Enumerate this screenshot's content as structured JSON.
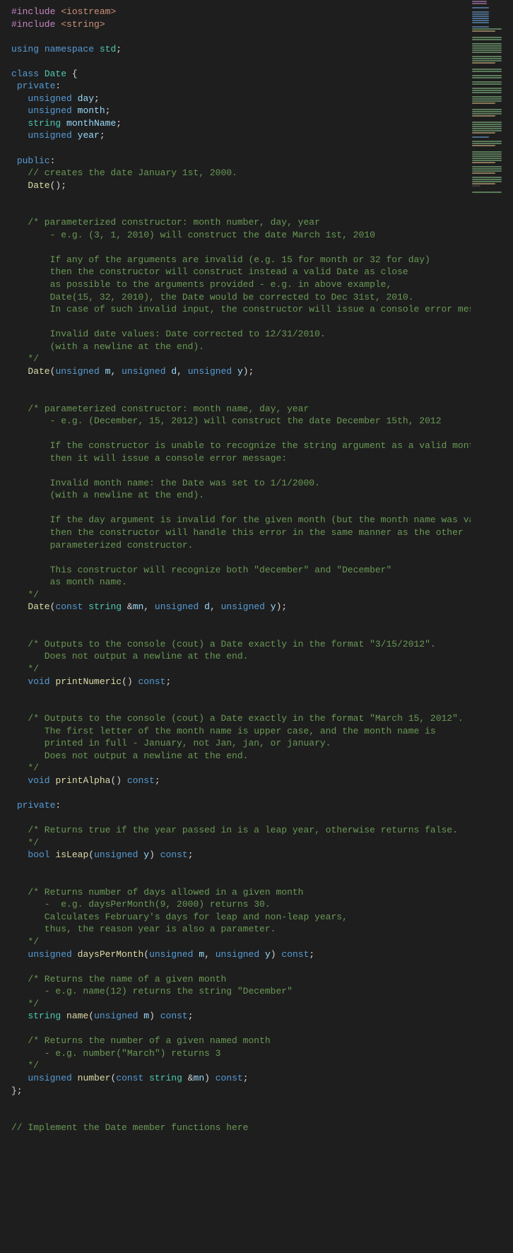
{
  "lines": [
    {
      "segs": [
        {
          "t": "#include",
          "c": "preproc"
        },
        {
          "t": " ",
          "c": "punct"
        },
        {
          "t": "<iostream>",
          "c": "include-path"
        }
      ]
    },
    {
      "segs": [
        {
          "t": "#include",
          "c": "preproc"
        },
        {
          "t": " ",
          "c": "punct"
        },
        {
          "t": "<string>",
          "c": "include-path"
        }
      ]
    },
    {
      "segs": []
    },
    {
      "segs": [
        {
          "t": "using",
          "c": "keyword"
        },
        {
          "t": " ",
          "c": "punct"
        },
        {
          "t": "namespace",
          "c": "keyword"
        },
        {
          "t": " ",
          "c": "punct"
        },
        {
          "t": "std",
          "c": "namespace"
        },
        {
          "t": ";",
          "c": "punct"
        }
      ]
    },
    {
      "segs": []
    },
    {
      "segs": [
        {
          "t": "class",
          "c": "keyword"
        },
        {
          "t": " ",
          "c": "punct"
        },
        {
          "t": "Date",
          "c": "class"
        },
        {
          "t": " {",
          "c": "punct"
        }
      ]
    },
    {
      "segs": [
        {
          "t": " ",
          "c": "punct"
        },
        {
          "t": "private",
          "c": "keyword"
        },
        {
          "t": ":",
          "c": "punct"
        }
      ]
    },
    {
      "segs": [
        {
          "t": "   ",
          "c": "punct"
        },
        {
          "t": "unsigned",
          "c": "type"
        },
        {
          "t": " ",
          "c": "punct"
        },
        {
          "t": "day",
          "c": "ident"
        },
        {
          "t": ";",
          "c": "punct"
        }
      ]
    },
    {
      "segs": [
        {
          "t": "   ",
          "c": "punct"
        },
        {
          "t": "unsigned",
          "c": "type"
        },
        {
          "t": " ",
          "c": "punct"
        },
        {
          "t": "month",
          "c": "ident"
        },
        {
          "t": ";",
          "c": "punct"
        }
      ]
    },
    {
      "segs": [
        {
          "t": "   ",
          "c": "punct"
        },
        {
          "t": "string",
          "c": "class"
        },
        {
          "t": " ",
          "c": "punct"
        },
        {
          "t": "monthName",
          "c": "ident"
        },
        {
          "t": ";",
          "c": "punct"
        }
      ]
    },
    {
      "segs": [
        {
          "t": "   ",
          "c": "punct"
        },
        {
          "t": "unsigned",
          "c": "type"
        },
        {
          "t": " ",
          "c": "punct"
        },
        {
          "t": "year",
          "c": "ident"
        },
        {
          "t": ";",
          "c": "punct"
        }
      ]
    },
    {
      "segs": []
    },
    {
      "segs": [
        {
          "t": " ",
          "c": "punct"
        },
        {
          "t": "public",
          "c": "keyword"
        },
        {
          "t": ":",
          "c": "punct"
        }
      ]
    },
    {
      "segs": [
        {
          "t": "   ",
          "c": "punct"
        },
        {
          "t": "// creates the date January 1st, 2000.",
          "c": "comment"
        }
      ]
    },
    {
      "segs": [
        {
          "t": "   ",
          "c": "punct"
        },
        {
          "t": "Date",
          "c": "func"
        },
        {
          "t": "();",
          "c": "punct"
        }
      ]
    },
    {
      "segs": []
    },
    {
      "segs": []
    },
    {
      "segs": [
        {
          "t": "   ",
          "c": "punct"
        },
        {
          "t": "/* parameterized constructor: month number, day, year ",
          "c": "comment"
        }
      ]
    },
    {
      "segs": [
        {
          "t": "       - e.g. (3, 1, 2010) will construct the date March 1st, 2010",
          "c": "comment"
        }
      ]
    },
    {
      "segs": []
    },
    {
      "segs": [
        {
          "t": "       If any of the arguments are invalid (e.g. 15 for month or 32 for day)",
          "c": "comment"
        }
      ]
    },
    {
      "segs": [
        {
          "t": "       then the constructor will construct instead a valid Date as close",
          "c": "comment"
        }
      ]
    },
    {
      "segs": [
        {
          "t": "       as possible to the arguments provided - e.g. in above example,",
          "c": "comment"
        }
      ]
    },
    {
      "segs": [
        {
          "t": "       Date(15, 32, 2010), the Date would be corrected to Dec 31st, 2010.",
          "c": "comment"
        }
      ]
    },
    {
      "segs": [
        {
          "t": "       In case of such invalid input, the constructor will issue a console error message: ",
          "c": "comment"
        }
      ]
    },
    {
      "segs": []
    },
    {
      "segs": [
        {
          "t": "       Invalid date values: Date corrected to 12/31/2010.",
          "c": "comment"
        }
      ]
    },
    {
      "segs": [
        {
          "t": "       (with a newline at the end).",
          "c": "comment"
        }
      ]
    },
    {
      "segs": [
        {
          "t": "   ",
          "c": "punct"
        },
        {
          "t": "*/",
          "c": "comment"
        }
      ]
    },
    {
      "segs": [
        {
          "t": "   ",
          "c": "punct"
        },
        {
          "t": "Date",
          "c": "func"
        },
        {
          "t": "(",
          "c": "punct"
        },
        {
          "t": "unsigned",
          "c": "type"
        },
        {
          "t": " ",
          "c": "punct"
        },
        {
          "t": "m",
          "c": "param"
        },
        {
          "t": ", ",
          "c": "punct"
        },
        {
          "t": "unsigned",
          "c": "type"
        },
        {
          "t": " ",
          "c": "punct"
        },
        {
          "t": "d",
          "c": "param"
        },
        {
          "t": ", ",
          "c": "punct"
        },
        {
          "t": "unsigned",
          "c": "type"
        },
        {
          "t": " ",
          "c": "punct"
        },
        {
          "t": "y",
          "c": "param"
        },
        {
          "t": ");",
          "c": "punct"
        }
      ]
    },
    {
      "segs": []
    },
    {
      "segs": []
    },
    {
      "segs": [
        {
          "t": "   ",
          "c": "punct"
        },
        {
          "t": "/* parameterized constructor: month name, day, year",
          "c": "comment"
        }
      ]
    },
    {
      "segs": [
        {
          "t": "       - e.g. (December, 15, 2012) will construct the date December 15th, 2012",
          "c": "comment"
        }
      ]
    },
    {
      "segs": []
    },
    {
      "segs": [
        {
          "t": "       If the constructor is unable to recognize the string argument as a valid month name,",
          "c": "comment"
        }
      ]
    },
    {
      "segs": [
        {
          "t": "       then it will issue a console error message: ",
          "c": "comment"
        }
      ]
    },
    {
      "segs": []
    },
    {
      "segs": [
        {
          "t": "       Invalid month name: the Date was set to 1/1/2000.",
          "c": "comment"
        }
      ]
    },
    {
      "segs": [
        {
          "t": "       (with a newline at the end).",
          "c": "comment"
        }
      ]
    },
    {
      "segs": []
    },
    {
      "segs": [
        {
          "t": "       If the day argument is invalid for the given month (but the month name was valid),",
          "c": "comment"
        }
      ]
    },
    {
      "segs": [
        {
          "t": "       then the constructor will handle this error in the same manner as the other",
          "c": "comment"
        }
      ]
    },
    {
      "segs": [
        {
          "t": "       parameterized constructor. ",
          "c": "comment"
        }
      ]
    },
    {
      "segs": []
    },
    {
      "segs": [
        {
          "t": "       This constructor will recognize both \"december\" and \"December\"",
          "c": "comment"
        }
      ]
    },
    {
      "segs": [
        {
          "t": "       as month name.",
          "c": "comment"
        }
      ]
    },
    {
      "segs": [
        {
          "t": "   ",
          "c": "punct"
        },
        {
          "t": "*/",
          "c": "comment"
        }
      ]
    },
    {
      "segs": [
        {
          "t": "   ",
          "c": "punct"
        },
        {
          "t": "Date",
          "c": "func"
        },
        {
          "t": "(",
          "c": "punct"
        },
        {
          "t": "const",
          "c": "keyword"
        },
        {
          "t": " ",
          "c": "punct"
        },
        {
          "t": "string",
          "c": "class"
        },
        {
          "t": " &",
          "c": "punct"
        },
        {
          "t": "mn",
          "c": "param"
        },
        {
          "t": ", ",
          "c": "punct"
        },
        {
          "t": "unsigned",
          "c": "type"
        },
        {
          "t": " ",
          "c": "punct"
        },
        {
          "t": "d",
          "c": "param"
        },
        {
          "t": ", ",
          "c": "punct"
        },
        {
          "t": "unsigned",
          "c": "type"
        },
        {
          "t": " ",
          "c": "punct"
        },
        {
          "t": "y",
          "c": "param"
        },
        {
          "t": ");",
          "c": "punct"
        }
      ]
    },
    {
      "segs": []
    },
    {
      "segs": []
    },
    {
      "segs": [
        {
          "t": "   ",
          "c": "punct"
        },
        {
          "t": "/* Outputs to the console (cout) a Date exactly in the format \"3/15/2012\".",
          "c": "comment"
        }
      ]
    },
    {
      "segs": [
        {
          "t": "      Does not output a newline at the end.",
          "c": "comment"
        }
      ]
    },
    {
      "segs": [
        {
          "t": "   ",
          "c": "punct"
        },
        {
          "t": "*/",
          "c": "comment"
        }
      ]
    },
    {
      "segs": [
        {
          "t": "   ",
          "c": "punct"
        },
        {
          "t": "void",
          "c": "type"
        },
        {
          "t": " ",
          "c": "punct"
        },
        {
          "t": "printNumeric",
          "c": "func"
        },
        {
          "t": "() ",
          "c": "punct"
        },
        {
          "t": "const",
          "c": "keyword"
        },
        {
          "t": ";",
          "c": "punct"
        }
      ]
    },
    {
      "segs": []
    },
    {
      "segs": []
    },
    {
      "segs": [
        {
          "t": "   ",
          "c": "punct"
        },
        {
          "t": "/* Outputs to the console (cout) a Date exactly in the format \"March 15, 2012\".",
          "c": "comment"
        }
      ]
    },
    {
      "segs": [
        {
          "t": "      The first letter of the month name is upper case, and the month name is",
          "c": "comment"
        }
      ]
    },
    {
      "segs": [
        {
          "t": "      printed in full - January, not Jan, jan, or january. ",
          "c": "comment"
        }
      ]
    },
    {
      "segs": [
        {
          "t": "      Does not output a newline at the end.",
          "c": "comment"
        }
      ]
    },
    {
      "segs": [
        {
          "t": "   ",
          "c": "punct"
        },
        {
          "t": "*/",
          "c": "comment"
        }
      ]
    },
    {
      "segs": [
        {
          "t": "   ",
          "c": "punct"
        },
        {
          "t": "void",
          "c": "type"
        },
        {
          "t": " ",
          "c": "punct"
        },
        {
          "t": "printAlpha",
          "c": "func"
        },
        {
          "t": "() ",
          "c": "punct"
        },
        {
          "t": "const",
          "c": "keyword"
        },
        {
          "t": ";",
          "c": "punct"
        }
      ]
    },
    {
      "segs": []
    },
    {
      "segs": [
        {
          "t": " ",
          "c": "punct"
        },
        {
          "t": "private",
          "c": "keyword"
        },
        {
          "t": ":",
          "c": "punct"
        }
      ]
    },
    {
      "segs": []
    },
    {
      "segs": [
        {
          "t": "   ",
          "c": "punct"
        },
        {
          "t": "/* Returns true if the year passed in is a leap year, otherwise returns false.",
          "c": "comment"
        }
      ]
    },
    {
      "segs": [
        {
          "t": "   ",
          "c": "punct"
        },
        {
          "t": "*/",
          "c": "comment"
        }
      ]
    },
    {
      "segs": [
        {
          "t": "   ",
          "c": "punct"
        },
        {
          "t": "bool",
          "c": "type"
        },
        {
          "t": " ",
          "c": "punct"
        },
        {
          "t": "isLeap",
          "c": "func"
        },
        {
          "t": "(",
          "c": "punct"
        },
        {
          "t": "unsigned",
          "c": "type"
        },
        {
          "t": " ",
          "c": "punct"
        },
        {
          "t": "y",
          "c": "param"
        },
        {
          "t": ") ",
          "c": "punct"
        },
        {
          "t": "const",
          "c": "keyword"
        },
        {
          "t": ";",
          "c": "punct"
        }
      ]
    },
    {
      "segs": []
    },
    {
      "segs": []
    },
    {
      "segs": [
        {
          "t": "   ",
          "c": "punct"
        },
        {
          "t": "/* Returns number of days allowed in a given month",
          "c": "comment"
        }
      ]
    },
    {
      "segs": [
        {
          "t": "      -  e.g. daysPerMonth(9, 2000) returns 30.",
          "c": "comment"
        }
      ]
    },
    {
      "segs": [
        {
          "t": "      Calculates February's days for leap and non-leap years,",
          "c": "comment"
        }
      ]
    },
    {
      "segs": [
        {
          "t": "      thus, the reason year is also a parameter.",
          "c": "comment"
        }
      ]
    },
    {
      "segs": [
        {
          "t": "   ",
          "c": "punct"
        },
        {
          "t": "*/",
          "c": "comment"
        }
      ]
    },
    {
      "segs": [
        {
          "t": "   ",
          "c": "punct"
        },
        {
          "t": "unsigned",
          "c": "type"
        },
        {
          "t": " ",
          "c": "punct"
        },
        {
          "t": "daysPerMonth",
          "c": "func"
        },
        {
          "t": "(",
          "c": "punct"
        },
        {
          "t": "unsigned",
          "c": "type"
        },
        {
          "t": " ",
          "c": "punct"
        },
        {
          "t": "m",
          "c": "param"
        },
        {
          "t": ", ",
          "c": "punct"
        },
        {
          "t": "unsigned",
          "c": "type"
        },
        {
          "t": " ",
          "c": "punct"
        },
        {
          "t": "y",
          "c": "param"
        },
        {
          "t": ") ",
          "c": "punct"
        },
        {
          "t": "const",
          "c": "keyword"
        },
        {
          "t": ";",
          "c": "punct"
        }
      ]
    },
    {
      "segs": []
    },
    {
      "segs": [
        {
          "t": "   ",
          "c": "punct"
        },
        {
          "t": "/* Returns the name of a given month",
          "c": "comment"
        }
      ]
    },
    {
      "segs": [
        {
          "t": "      - e.g. name(12) returns the string \"December\"",
          "c": "comment"
        }
      ]
    },
    {
      "segs": [
        {
          "t": "   ",
          "c": "punct"
        },
        {
          "t": "*/",
          "c": "comment"
        }
      ]
    },
    {
      "segs": [
        {
          "t": "   ",
          "c": "punct"
        },
        {
          "t": "string",
          "c": "class"
        },
        {
          "t": " ",
          "c": "punct"
        },
        {
          "t": "name",
          "c": "func"
        },
        {
          "t": "(",
          "c": "punct"
        },
        {
          "t": "unsigned",
          "c": "type"
        },
        {
          "t": " ",
          "c": "punct"
        },
        {
          "t": "m",
          "c": "param"
        },
        {
          "t": ") ",
          "c": "punct"
        },
        {
          "t": "const",
          "c": "keyword"
        },
        {
          "t": ";",
          "c": "punct"
        }
      ]
    },
    {
      "segs": []
    },
    {
      "segs": [
        {
          "t": "   ",
          "c": "punct"
        },
        {
          "t": "/* Returns the number of a given named month",
          "c": "comment"
        }
      ]
    },
    {
      "segs": [
        {
          "t": "      - e.g. number(\"March\") returns 3",
          "c": "comment"
        }
      ]
    },
    {
      "segs": [
        {
          "t": "   ",
          "c": "punct"
        },
        {
          "t": "*/",
          "c": "comment"
        }
      ]
    },
    {
      "segs": [
        {
          "t": "   ",
          "c": "punct"
        },
        {
          "t": "unsigned",
          "c": "type"
        },
        {
          "t": " ",
          "c": "punct"
        },
        {
          "t": "number",
          "c": "func"
        },
        {
          "t": "(",
          "c": "punct"
        },
        {
          "t": "const",
          "c": "keyword"
        },
        {
          "t": " ",
          "c": "punct"
        },
        {
          "t": "string",
          "c": "class"
        },
        {
          "t": " &",
          "c": "punct"
        },
        {
          "t": "mn",
          "c": "param"
        },
        {
          "t": ") ",
          "c": "punct"
        },
        {
          "t": "const",
          "c": "keyword"
        },
        {
          "t": ";",
          "c": "punct"
        }
      ]
    },
    {
      "segs": [
        {
          "t": "};",
          "c": "punct"
        }
      ]
    },
    {
      "segs": []
    },
    {
      "segs": []
    },
    {
      "segs": [
        {
          "t": "// Implement the Date member functions here",
          "c": "comment"
        }
      ]
    }
  ],
  "minimap_pattern": [
    "c3",
    "c3",
    "sp",
    "c2",
    "sp",
    "c2",
    "c2",
    "c2",
    "c2",
    "c2",
    "c2",
    "sp",
    "c2",
    "c1",
    "c5",
    "sp",
    "sp",
    "c1",
    "c1",
    "sp",
    "c1",
    "c1",
    "c1",
    "c1",
    "c1",
    "sp",
    "c1",
    "c1",
    "c1",
    "c5",
    "sp",
    "sp",
    "c1",
    "c1",
    "sp",
    "c1",
    "c1",
    "sp",
    "c1",
    "c1",
    "sp",
    "c1",
    "c1",
    "c1",
    "sp",
    "c1",
    "c1",
    "c1",
    "c5",
    "sp",
    "sp",
    "c1",
    "c1",
    "c1",
    "c5",
    "sp",
    "sp",
    "c1",
    "c1",
    "c1",
    "c1",
    "c1",
    "c5",
    "sp",
    "c2",
    "sp",
    "c1",
    "c1",
    "c5",
    "sp",
    "sp",
    "c1",
    "c1",
    "c1",
    "c1",
    "c1",
    "c5",
    "sp",
    "c1",
    "c1",
    "c1",
    "c5",
    "sp",
    "c1",
    "c1",
    "c1",
    "c5",
    "c4",
    "sp",
    "sp",
    "c1"
  ]
}
